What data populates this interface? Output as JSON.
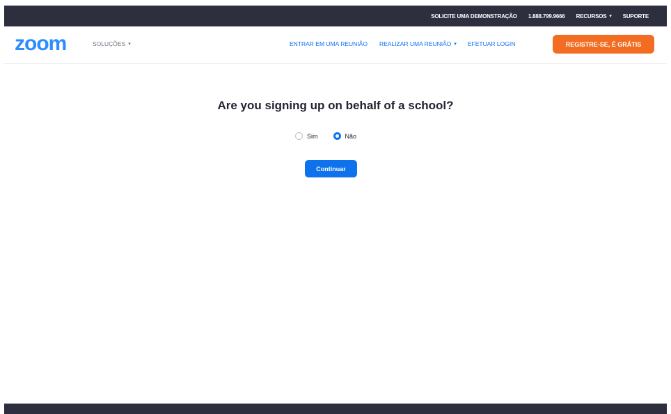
{
  "topbar": {
    "demo_label": "SOLICITE UMA DEMONSTRAÇÃO",
    "phone": "1.888.799.9666",
    "recursos_label": "RECURSOS",
    "suporte_label": "SUPORTE"
  },
  "navbar": {
    "logo": "zoom",
    "solucoes_label": "SOLUÇÕES",
    "join_label": "ENTRAR EM UMA REUNIÃO",
    "host_label": "REALIZAR UMA REUNIÃO",
    "login_label": "EFETUAR LOGIN",
    "signup_label": "REGISTRE-SE, É GRÁTIS"
  },
  "form": {
    "question": "Are you signing up on behalf of a school?",
    "options": [
      {
        "label": "Sim",
        "checked": false
      },
      {
        "label": "Não",
        "checked": true
      }
    ],
    "continue_label": "Continuar"
  },
  "colors": {
    "header_bg": "#2d2f3f",
    "brand_blue": "#2d8cff",
    "link_blue": "#0e72ed",
    "signup_orange": "#f26d21"
  },
  "icons": {
    "dropdown": "chevron-down-icon"
  }
}
